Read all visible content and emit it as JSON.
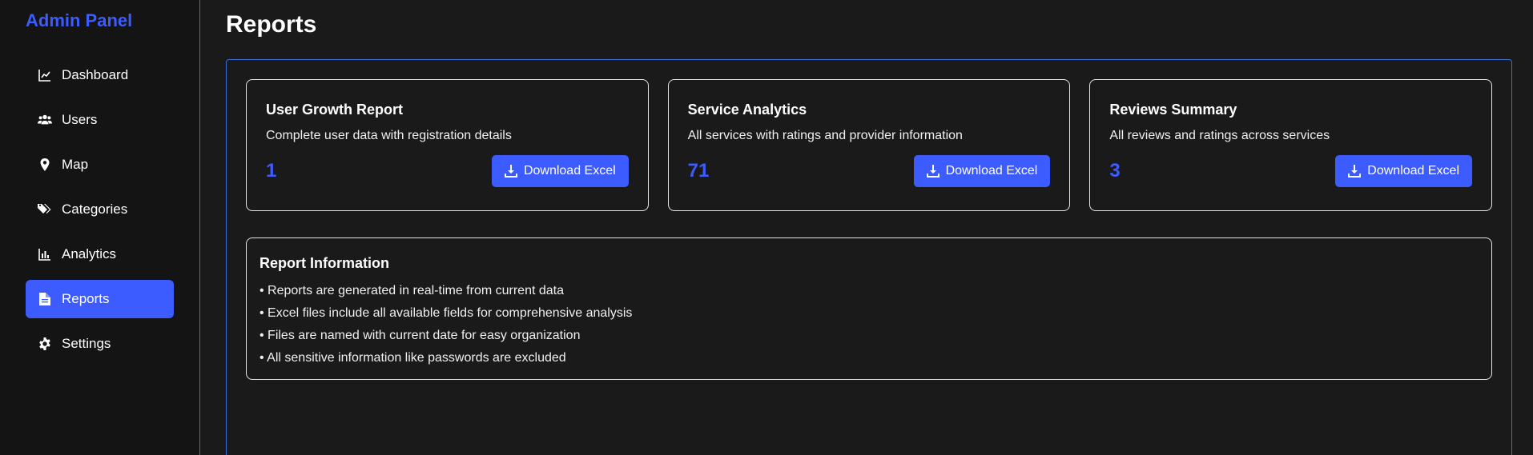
{
  "sidebar": {
    "brand": "Admin Panel",
    "items": [
      {
        "label": "Dashboard",
        "icon": "chart-line-icon",
        "active": false
      },
      {
        "label": "Users",
        "icon": "users-icon",
        "active": false
      },
      {
        "label": "Map",
        "icon": "map-pin-icon",
        "active": false
      },
      {
        "label": "Categories",
        "icon": "tags-icon",
        "active": false
      },
      {
        "label": "Analytics",
        "icon": "bar-chart-icon",
        "active": false
      },
      {
        "label": "Reports",
        "icon": "file-icon",
        "active": true
      },
      {
        "label": "Settings",
        "icon": "gear-icon",
        "active": false
      }
    ]
  },
  "main": {
    "title": "Reports",
    "cards": [
      {
        "title": "User Growth Report",
        "description": "Complete user data with registration details",
        "count": "1",
        "button_label": "Download Excel"
      },
      {
        "title": "Service Analytics",
        "description": "All services with ratings and provider information",
        "count": "71",
        "button_label": "Download Excel"
      },
      {
        "title": "Reviews Summary",
        "description": "All reviews and ratings across services",
        "count": "3",
        "button_label": "Download Excel"
      }
    ],
    "info": {
      "title": "Report Information",
      "items": [
        "• Reports are generated in real-time from current data",
        "• Excel files include all available fields for comprehensive analysis",
        "• Files are named with current date for easy organization",
        "• All sensitive information like passwords are excluded"
      ]
    }
  },
  "colors": {
    "accent": "#3d5cff",
    "background": "#1a1a1a",
    "sidebar_bg": "#141414",
    "panel_border": "#3a6fd8"
  }
}
